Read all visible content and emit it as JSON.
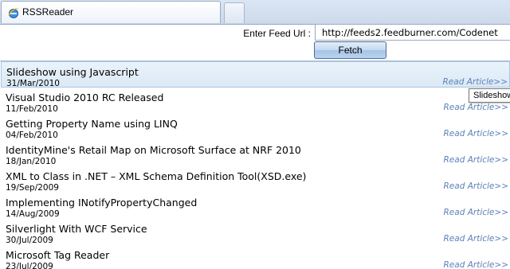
{
  "tab": {
    "title": "RSSReader",
    "icon": "ie-icon"
  },
  "feed": {
    "url_label": "Enter Feed Url :",
    "url_value": "http://feeds2.feedburner.com/Codenet",
    "fetch_label": "Fetch"
  },
  "articles": [
    {
      "title": "Slideshow using Javascript",
      "date": "31/Mar/2010",
      "link": "Read Article>>"
    },
    {
      "title": "Visual Studio 2010 RC Released",
      "date": "11/Feb/2010",
      "link": "Read Article>>"
    },
    {
      "title": "Getting Property Name using LINQ",
      "date": "04/Feb/2010",
      "link": "Read Article>>"
    },
    {
      "title": "IdentityMine's Retail Map on Microsoft Surface at NRF 2010",
      "date": "18/Jan/2010",
      "link": "Read Article>>"
    },
    {
      "title": "XML to Class in .NET – XML Schema Definition Tool(XSD.exe)",
      "date": "19/Sep/2009",
      "link": "Read Article>>"
    },
    {
      "title": "Implementing INotifyPropertyChanged",
      "date": "14/Aug/2009",
      "link": "Read Article>>"
    },
    {
      "title": "Silverlight With WCF Service",
      "date": "30/Jul/2009",
      "link": "Read Article>>"
    },
    {
      "title": "Microsoft Tag Reader",
      "date": "23/Jul/2009",
      "link": "Read Article>>"
    }
  ],
  "tooltip": {
    "text": "Slideshow"
  },
  "colors": {
    "link": "#5b82b8",
    "selected_row": "#dbe9f6",
    "accent_border": "#4e6d95"
  }
}
